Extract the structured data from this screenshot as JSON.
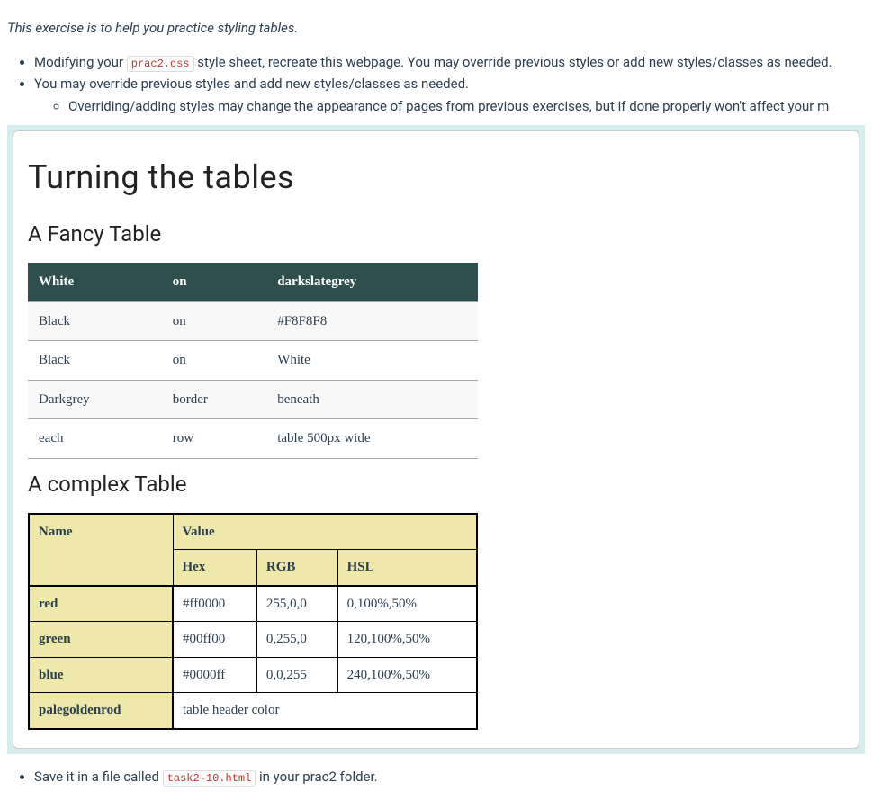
{
  "intro": "This exercise is to help you practice styling tables.",
  "bullets": {
    "b1_pre": "Modifying your ",
    "b1_code": "prac2.css",
    "b1_post": " style sheet, recreate this webpage. You may override previous styles or add new styles/classes as needed.",
    "b2": "You may override previous styles and add new styles/classes as needed.",
    "b2a": "Overriding/adding styles may change the appearance of pages from previous exercises, but if done properly won't affect your m"
  },
  "example": {
    "h1": "Turning the tables",
    "h2a": "A Fancy Table",
    "h2b": "A complex Table"
  },
  "fancy": {
    "header": {
      "c1": "White",
      "c2": "on",
      "c3": "darkslategrey"
    },
    "rows": [
      {
        "c1": "Black",
        "c2": "on",
        "c3": "#F8F8F8"
      },
      {
        "c1": "Black",
        "c2": "on",
        "c3": "White"
      },
      {
        "c1": "Darkgrey",
        "c2": "border",
        "c3": "beneath"
      },
      {
        "c1": "each",
        "c2": "row",
        "c3": "table 500px wide"
      }
    ]
  },
  "complex": {
    "head": {
      "name": "Name",
      "value": "Value",
      "hex": "Hex",
      "rgb": "RGB",
      "hsl": "HSL"
    },
    "rows": [
      {
        "name": "red",
        "hex": "#ff0000",
        "rgb": "255,0,0",
        "hsl": "0,100%,50%"
      },
      {
        "name": "green",
        "hex": "#00ff00",
        "rgb": "0,255,0",
        "hsl": "120,100%,50%"
      },
      {
        "name": "blue",
        "hex": "#0000ff",
        "rgb": "0,0,255",
        "hsl": "240,100%,50%"
      }
    ],
    "footer": {
      "name": "palegoldenrod",
      "desc": "table header color"
    }
  },
  "foot": {
    "pre": "Save it in a file called ",
    "code": "task2-10.html",
    "post": " in your prac2 folder."
  }
}
